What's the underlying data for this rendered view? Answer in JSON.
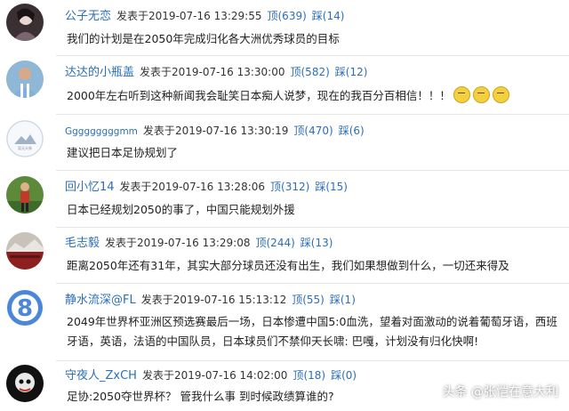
{
  "labels": {
    "posted": "发表于",
    "up": "顶",
    "down": "踩"
  },
  "comments": [
    {
      "user": "公子无恋",
      "time": "2019-07-16 13:29:55",
      "up": "(639)",
      "down": "(14)",
      "text": "我们的计划是在2050年完成归化各大洲优秀球员的目标"
    },
    {
      "user": "达达的小瓶盖",
      "time": "2019-07-16 13:30:00",
      "up": "(582)",
      "down": "(12)",
      "text": "2000年左右听到这种新闻我会耻笑日本痴人说梦，现在的我百分百相信！！！"
    },
    {
      "user": "Gggggggggmm",
      "time": "2019-07-16 13:30:19",
      "up": "(470)",
      "down": "(6)",
      "text": "建议把日本足协规划了"
    },
    {
      "user": "回小忆14",
      "time": "2019-07-16 13:28:06",
      "up": "(312)",
      "down": "(15)",
      "text": "日本已经规划2050的事了，中国只能规划外援"
    },
    {
      "user": "毛志毅",
      "time": "2019-07-16 13:29:08",
      "up": "(244)",
      "down": "(13)",
      "text": "距离2050年还有31年，其实大部分球员还没有出生，我们如果想做到什么，一切还来得及"
    },
    {
      "user": "静水流深@FL",
      "time": "2019-07-16 15:13:12",
      "up": "(55)",
      "down": "(1)",
      "text": "2049年世界杯亚洲区预选赛最后一场，日本惨遭中国5:0血洗，望着对面激动的说着葡萄牙语，西班牙语，英语，法语的中国队员，日本球员们不禁仰天长啸: 巴嘎，计划没有归化快啊!"
    },
    {
      "user": "守夜人_ZxCH",
      "time": "2019-07-16 14:02:00",
      "up": "(18)",
      "down": "(0)",
      "text": "足协:2050夺世界杯？ 管我什么事 到时候政绩算谁的?"
    }
  ],
  "watermark": "头条 @张恺在意大利",
  "colors": {
    "link": "#2b6fb6",
    "text": "#222222",
    "divider": "#e6e6e6"
  }
}
